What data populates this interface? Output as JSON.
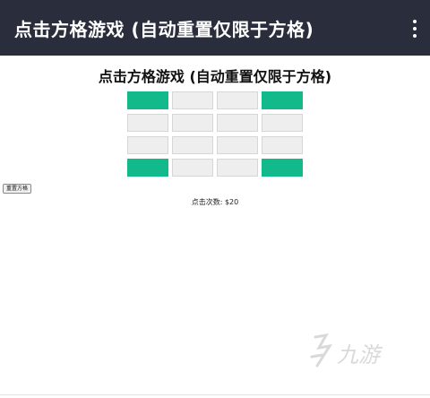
{
  "app_bar": {
    "title": "点击方格游戏 (自动重置仅限于方格)",
    "menu_icon": "more-vert-icon"
  },
  "page": {
    "heading": "点击方格游戏 (自动重置仅限于方格)",
    "reset_button": "重置方格",
    "counter_label": "点击次数: $20"
  },
  "grid": {
    "rows": 4,
    "columns": 4,
    "active_color": "#12b98a",
    "inactive_color": "#eeeeee",
    "cells": [
      [
        true,
        false,
        false,
        true
      ],
      [
        false,
        false,
        false,
        false
      ],
      [
        false,
        false,
        false,
        false
      ],
      [
        true,
        false,
        false,
        true
      ]
    ]
  },
  "colors": {
    "app_bar_background": "#2a2d3b",
    "app_bar_text": "#ffffff"
  },
  "watermark": {
    "text": "九游",
    "logo": "jiuyou-logo-icon"
  }
}
